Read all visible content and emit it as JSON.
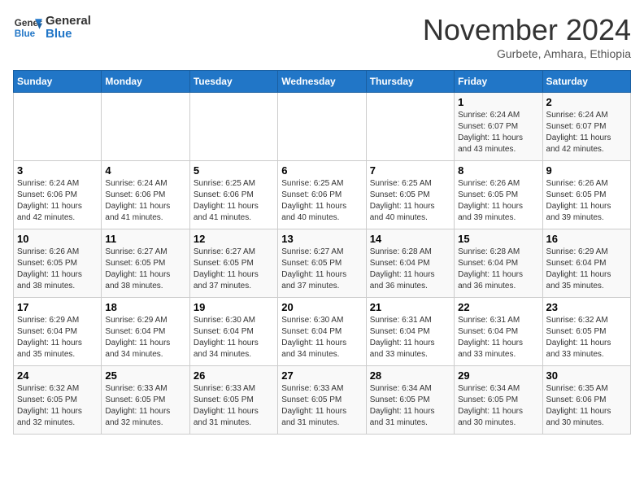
{
  "header": {
    "logo_line1": "General",
    "logo_line2": "Blue",
    "month": "November 2024",
    "location": "Gurbete, Amhara, Ethiopia"
  },
  "weekdays": [
    "Sunday",
    "Monday",
    "Tuesday",
    "Wednesday",
    "Thursday",
    "Friday",
    "Saturday"
  ],
  "weeks": [
    [
      {
        "day": "",
        "info": ""
      },
      {
        "day": "",
        "info": ""
      },
      {
        "day": "",
        "info": ""
      },
      {
        "day": "",
        "info": ""
      },
      {
        "day": "",
        "info": ""
      },
      {
        "day": "1",
        "info": "Sunrise: 6:24 AM\nSunset: 6:07 PM\nDaylight: 11 hours\nand 43 minutes."
      },
      {
        "day": "2",
        "info": "Sunrise: 6:24 AM\nSunset: 6:07 PM\nDaylight: 11 hours\nand 42 minutes."
      }
    ],
    [
      {
        "day": "3",
        "info": "Sunrise: 6:24 AM\nSunset: 6:06 PM\nDaylight: 11 hours\nand 42 minutes."
      },
      {
        "day": "4",
        "info": "Sunrise: 6:24 AM\nSunset: 6:06 PM\nDaylight: 11 hours\nand 41 minutes."
      },
      {
        "day": "5",
        "info": "Sunrise: 6:25 AM\nSunset: 6:06 PM\nDaylight: 11 hours\nand 41 minutes."
      },
      {
        "day": "6",
        "info": "Sunrise: 6:25 AM\nSunset: 6:06 PM\nDaylight: 11 hours\nand 40 minutes."
      },
      {
        "day": "7",
        "info": "Sunrise: 6:25 AM\nSunset: 6:05 PM\nDaylight: 11 hours\nand 40 minutes."
      },
      {
        "day": "8",
        "info": "Sunrise: 6:26 AM\nSunset: 6:05 PM\nDaylight: 11 hours\nand 39 minutes."
      },
      {
        "day": "9",
        "info": "Sunrise: 6:26 AM\nSunset: 6:05 PM\nDaylight: 11 hours\nand 39 minutes."
      }
    ],
    [
      {
        "day": "10",
        "info": "Sunrise: 6:26 AM\nSunset: 6:05 PM\nDaylight: 11 hours\nand 38 minutes."
      },
      {
        "day": "11",
        "info": "Sunrise: 6:27 AM\nSunset: 6:05 PM\nDaylight: 11 hours\nand 38 minutes."
      },
      {
        "day": "12",
        "info": "Sunrise: 6:27 AM\nSunset: 6:05 PM\nDaylight: 11 hours\nand 37 minutes."
      },
      {
        "day": "13",
        "info": "Sunrise: 6:27 AM\nSunset: 6:05 PM\nDaylight: 11 hours\nand 37 minutes."
      },
      {
        "day": "14",
        "info": "Sunrise: 6:28 AM\nSunset: 6:04 PM\nDaylight: 11 hours\nand 36 minutes."
      },
      {
        "day": "15",
        "info": "Sunrise: 6:28 AM\nSunset: 6:04 PM\nDaylight: 11 hours\nand 36 minutes."
      },
      {
        "day": "16",
        "info": "Sunrise: 6:29 AM\nSunset: 6:04 PM\nDaylight: 11 hours\nand 35 minutes."
      }
    ],
    [
      {
        "day": "17",
        "info": "Sunrise: 6:29 AM\nSunset: 6:04 PM\nDaylight: 11 hours\nand 35 minutes."
      },
      {
        "day": "18",
        "info": "Sunrise: 6:29 AM\nSunset: 6:04 PM\nDaylight: 11 hours\nand 34 minutes."
      },
      {
        "day": "19",
        "info": "Sunrise: 6:30 AM\nSunset: 6:04 PM\nDaylight: 11 hours\nand 34 minutes."
      },
      {
        "day": "20",
        "info": "Sunrise: 6:30 AM\nSunset: 6:04 PM\nDaylight: 11 hours\nand 34 minutes."
      },
      {
        "day": "21",
        "info": "Sunrise: 6:31 AM\nSunset: 6:04 PM\nDaylight: 11 hours\nand 33 minutes."
      },
      {
        "day": "22",
        "info": "Sunrise: 6:31 AM\nSunset: 6:04 PM\nDaylight: 11 hours\nand 33 minutes."
      },
      {
        "day": "23",
        "info": "Sunrise: 6:32 AM\nSunset: 6:05 PM\nDaylight: 11 hours\nand 33 minutes."
      }
    ],
    [
      {
        "day": "24",
        "info": "Sunrise: 6:32 AM\nSunset: 6:05 PM\nDaylight: 11 hours\nand 32 minutes."
      },
      {
        "day": "25",
        "info": "Sunrise: 6:33 AM\nSunset: 6:05 PM\nDaylight: 11 hours\nand 32 minutes."
      },
      {
        "day": "26",
        "info": "Sunrise: 6:33 AM\nSunset: 6:05 PM\nDaylight: 11 hours\nand 31 minutes."
      },
      {
        "day": "27",
        "info": "Sunrise: 6:33 AM\nSunset: 6:05 PM\nDaylight: 11 hours\nand 31 minutes."
      },
      {
        "day": "28",
        "info": "Sunrise: 6:34 AM\nSunset: 6:05 PM\nDaylight: 11 hours\nand 31 minutes."
      },
      {
        "day": "29",
        "info": "Sunrise: 6:34 AM\nSunset: 6:05 PM\nDaylight: 11 hours\nand 30 minutes."
      },
      {
        "day": "30",
        "info": "Sunrise: 6:35 AM\nSunset: 6:06 PM\nDaylight: 11 hours\nand 30 minutes."
      }
    ]
  ]
}
